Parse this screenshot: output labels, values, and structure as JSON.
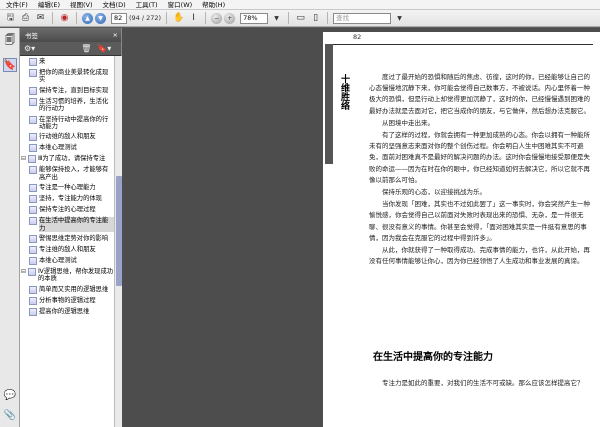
{
  "menubar": {
    "items": [
      "文件(F)",
      "编辑(E)",
      "视图(V)",
      "文档(D)",
      "工具(T)",
      "窗口(W)",
      "帮助(H)"
    ]
  },
  "toolbar": {
    "page_current": "82",
    "page_total": "(94 / 272)",
    "zoom": "78%",
    "search_placeholder": "查找"
  },
  "panel": {
    "title": "书签",
    "close": "×"
  },
  "bookmarks": [
    {
      "level": 1,
      "label": "来"
    },
    {
      "level": 1,
      "label": "把你的商业美景转化成现实"
    },
    {
      "level": 1,
      "label": "保持专注，直到目标实现"
    },
    {
      "level": 1,
      "label": "生活习惯的培养，生活化的行动力"
    },
    {
      "level": 1,
      "label": "在坚持行动中提高你的行动能力"
    },
    {
      "level": 1,
      "label": "行动维的敌人和朋友"
    },
    {
      "level": 1,
      "label": "本维心理测试"
    },
    {
      "level": 0,
      "label": "Ⅲ为了成功，请保持专注",
      "twisty": "⊟"
    },
    {
      "level": 1,
      "label": "能够保持投入，才能够有高产出"
    },
    {
      "level": 1,
      "label": "专注是一种心理能力"
    },
    {
      "level": 1,
      "label": "坚持，专注能力的体现"
    },
    {
      "level": 1,
      "label": "保持专注的心理过程"
    },
    {
      "level": 1,
      "label": "在生活中提高你的专注能力",
      "selected": true
    },
    {
      "level": 1,
      "label": "警惕思维定势对你的影响"
    },
    {
      "level": 1,
      "label": "专注维的敌人和朋友"
    },
    {
      "level": 1,
      "label": "本维心理测试"
    },
    {
      "level": 0,
      "label": "Ⅳ逻辑思维，帮你发现成功的本质",
      "twisty": "⊟"
    },
    {
      "level": 1,
      "label": "简单而又实用的逻辑思维"
    },
    {
      "level": 1,
      "label": "分析事物的逻辑过程"
    },
    {
      "level": 1,
      "label": "提高你的逻辑思维"
    }
  ],
  "page": {
    "number": "82",
    "chapter_title": "十维胜络",
    "paragraphs": [
      "度过了最开始的恐惧和随后的焦虑、彷徨，这时的你，已经能够让自己的心态慢慢地沉静下来，你可能会觉得自己数事方，不被说话。内心里怀着一种极大的恐惧，但是行动上却觉得更加沉静了，这时的你，已经慢慢遇到困难的最好办法就是去面对它，把它当成你的朋友，与它做伴，然后想办法克服它。",
      "从困境中走出来。",
      "有了这样的过程，你就会拥有一种更加成熟的心态。你会以拥有一种能所未有的坚强意志来面对你的整个创伤过程。你会明白人生中困难其实不可避免，面前对困难真不是最好的解决问题的办法。这时你会慢慢地接受那便是失败的命运——因为在时在你的眼中，你已经知道如何去解决它，所以它就不再像以前那么可怕。",
      "保持乐观的心态，以迎接挑战为乐。",
      "当你发现「困难，其实也不过如此罢了」这一事实时，你会突然产生一种愉悦感，你会觉得自己以前面对失败时表现出来的恐惧、无杂，是一件很无聊、很没有意义的事情。你甚至会觉得，「面对困难其实是一件挺有意思的事情，因为我会在克服它的过程中得到许多」。",
      "从此，你就获得了一种取得成功、完成事情的能力，也许，从此开始，再没有任何事情能够让你心，因为你已经领悟了人生成功和事业发展的真谛。"
    ],
    "section_heading": "在生活中提高你的专注能力",
    "last_paragraph": "专注力是如此的重要，对我们的生活不可或缺。那么应该怎样提高它？"
  }
}
